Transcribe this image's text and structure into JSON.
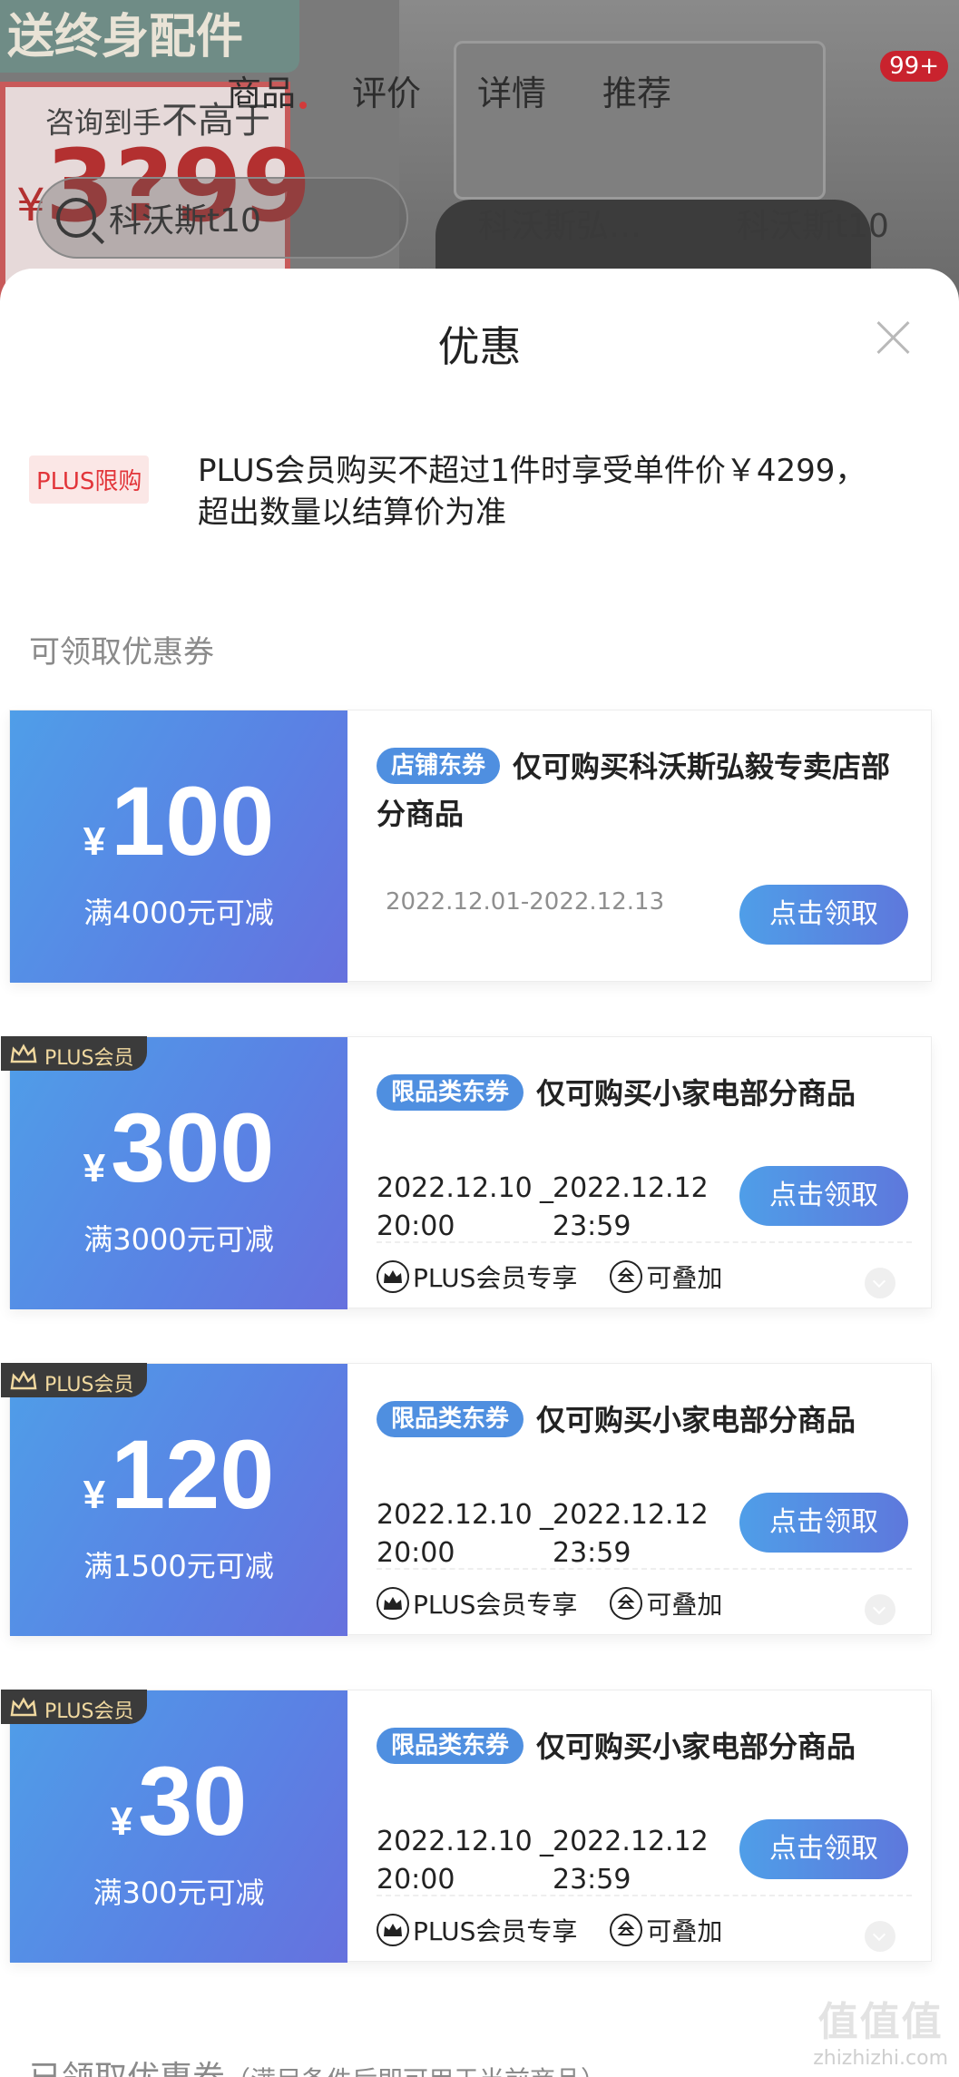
{
  "background": {
    "promo_text": "送终身配件",
    "consult_prefix": "咨询到手",
    "consult_emph": "不高于",
    "price_symbol": "¥",
    "price_value": "3?99",
    "tabs": [
      "商品",
      "评价",
      "详情",
      "推荐"
    ],
    "badge": "99+",
    "search_text": "科沃斯t10",
    "history": [
      "科沃斯弘…",
      "科沃斯t10"
    ]
  },
  "sheet": {
    "title": "优惠",
    "plus_tag": "PLUS限购",
    "plus_text": "PLUS会员购买不超过1件时享受单件价￥4299，超出数量以结算价为准",
    "section_title": "可领取优惠券",
    "bottom_title": "已领取优惠券",
    "bottom_note": "（满足条件后即可用于当前商品）"
  },
  "coupons": [
    {
      "yen": "¥",
      "amount": "100",
      "condition": "满4000元可减",
      "tag": "店铺东券",
      "desc": "仅可购买科沃斯弘毅专卖店部分商品",
      "date": "2022.12.01-2022.12.13",
      "button": "点击领取"
    },
    {
      "plus_badge": "PLUS会员",
      "yen": "¥",
      "amount": "300",
      "condition": "满3000元可减",
      "tag": "限品类东券",
      "desc": "仅可购买小家电部分商品",
      "date_start": "2022.12.10 20:00",
      "date_sep": "_",
      "date_end": "2022.12.12 23:59",
      "button": "点击领取",
      "meta1": "PLUS会员专享",
      "meta2": "可叠加"
    },
    {
      "plus_badge": "PLUS会员",
      "yen": "¥",
      "amount": "120",
      "condition": "满1500元可减",
      "tag": "限品类东券",
      "desc": "仅可购买小家电部分商品",
      "date_start": "2022.12.10 20:00",
      "date_sep": "_",
      "date_end": "2022.12.12 23:59",
      "button": "点击领取",
      "meta1": "PLUS会员专享",
      "meta2": "可叠加"
    },
    {
      "plus_badge": "PLUS会员",
      "yen": "¥",
      "amount": "30",
      "condition": "满300元可减",
      "tag": "限品类东券",
      "desc": "仅可购买小家电部分商品",
      "date_start": "2022.12.10 20:00",
      "date_sep": "_",
      "date_end": "2022.12.12 23:59",
      "button": "点击领取",
      "meta1": "PLUS会员专享",
      "meta2": "可叠加"
    }
  ],
  "watermark": {
    "logo": "值值值",
    "site": "zhizhizhi.com"
  },
  "colors": {
    "accent_blue": "#4f8fe0",
    "plus_red": "#e2353a",
    "plus_badge_bg": "#3b3b3b",
    "plus_badge_text": "#f1d9a0"
  }
}
